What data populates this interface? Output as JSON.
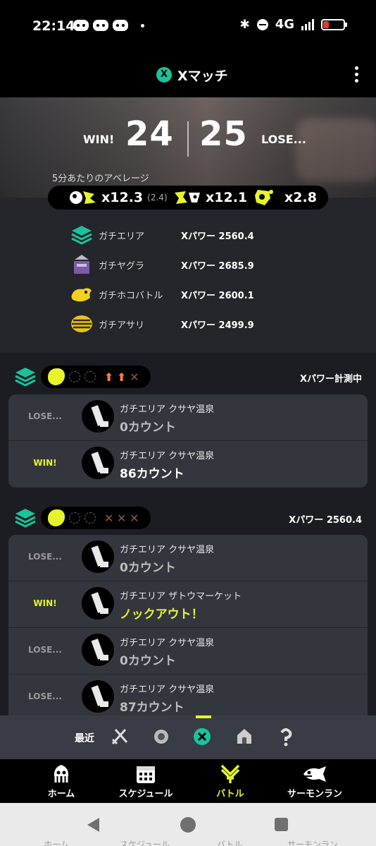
{
  "status_bar": {
    "time": "22:14",
    "network": "4G",
    "icons": [
      "discord-icon",
      "discord-icon",
      "discord-icon",
      "bluetooth-icon",
      "dnd-icon",
      "signal-icon",
      "battery-icon"
    ]
  },
  "header": {
    "title": "Xマッチ",
    "badge": "X",
    "menu_icon": "more-vert-icon"
  },
  "summary": {
    "win_label": "WIN!",
    "win_count": "24",
    "lose_count": "25",
    "lose_label": "LOSE...",
    "average_caption": "5分あたりのアベレージ",
    "stats": {
      "kill_assist": "x12.3",
      "assist": "(2.4)",
      "death": "x12.1",
      "special": "x2.8"
    }
  },
  "rules": [
    {
      "name": "ガチエリア",
      "power": "Xパワー 2560.4",
      "icon": "splat-zones-icon"
    },
    {
      "name": "ガチヤグラ",
      "power": "Xパワー 2685.9",
      "icon": "tower-control-icon"
    },
    {
      "name": "ガチホコバトル",
      "power": "Xパワー 2600.1",
      "icon": "rainmaker-icon"
    },
    {
      "name": "ガチアサリ",
      "power": "Xパワー 2499.9",
      "icon": "clam-blitz-icon"
    }
  ],
  "series": [
    {
      "power_text": "Xパワー計測中",
      "matches": [
        {
          "result": "LOSE...",
          "stage": "ガチエリア クサヤ温泉",
          "count": "0カウント"
        },
        {
          "result": "WIN!",
          "stage": "ガチエリア クサヤ温泉",
          "count": "86カウント"
        }
      ]
    },
    {
      "power_text": "Xパワー 2560.4",
      "matches": [
        {
          "result": "LOSE...",
          "stage": "ガチエリア クサヤ温泉",
          "count": "0カウント"
        },
        {
          "result": "WIN!",
          "stage": "ガチエリア ザトウマーケット",
          "count": "ノックアウト！"
        },
        {
          "result": "LOSE...",
          "stage": "ガチエリア クサヤ温泉",
          "count": "0カウント"
        },
        {
          "result": "LOSE...",
          "stage": "ガチエリア クサヤ温泉",
          "count": "87カウント"
        }
      ]
    }
  ],
  "filter": {
    "label": "最近",
    "icons": [
      "regular-battle-icon",
      "anarchy-battle-icon",
      "x-battle-icon",
      "private-battle-icon",
      "challenge-icon"
    ],
    "selected": "x-battle-icon"
  },
  "bottom_nav": {
    "items": [
      {
        "label": "ホーム",
        "icon": "squid-home-icon"
      },
      {
        "label": "スケジュール",
        "icon": "calendar-icon"
      },
      {
        "label": "バトル",
        "icon": "battle-icon"
      },
      {
        "label": "サーモンラン",
        "icon": "salmon-icon"
      }
    ],
    "active": "バトル"
  },
  "system_nav": {
    "ghost_labels": [
      "ホーム",
      "スケジュール",
      "バトル",
      "サーモンラン"
    ]
  },
  "colors": {
    "accent_yellow": "#e6f52a",
    "x_green": "#19c39b",
    "zones_green": "#19c39b",
    "arrow_orange": "#f57f45"
  }
}
